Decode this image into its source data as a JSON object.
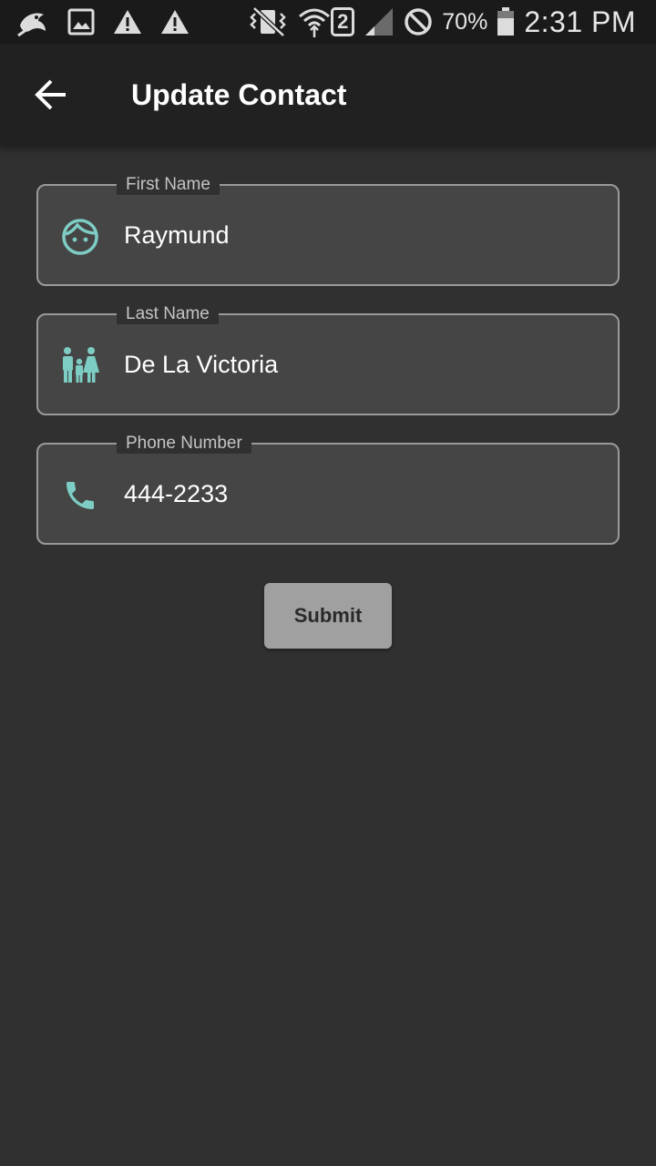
{
  "status_bar": {
    "left_icons": [
      "bird-notification-icon",
      "image-notification-icon",
      "warning-icon",
      "warning-icon"
    ],
    "right_icons": [
      "vibrate-icon",
      "wifi-icon",
      "sim-2-icon",
      "signal-icon",
      "do-not-disturb-icon",
      "battery-icon"
    ],
    "sim_label": "2",
    "battery": "70%",
    "time": "2:31 PM"
  },
  "app_bar": {
    "title": "Update Contact",
    "back_icon": "arrow-back-icon"
  },
  "form": {
    "first_name": {
      "label": "First Name",
      "value": "Raymund",
      "icon": "face-icon"
    },
    "last_name": {
      "label": "Last Name",
      "value": "De La Victoria",
      "icon": "family-icon"
    },
    "phone_number": {
      "label": "Phone Number",
      "value": "444-2233",
      "icon": "phone-icon"
    }
  },
  "submit_label": "Submit",
  "colors": {
    "background": "#303030",
    "app_bar": "#212121",
    "status_bar": "#1a1a1a",
    "field_fill": "#454545",
    "field_border": "#9a9a9a",
    "accent_icon": "#7ecdc4",
    "button": "#a0a0a0"
  }
}
